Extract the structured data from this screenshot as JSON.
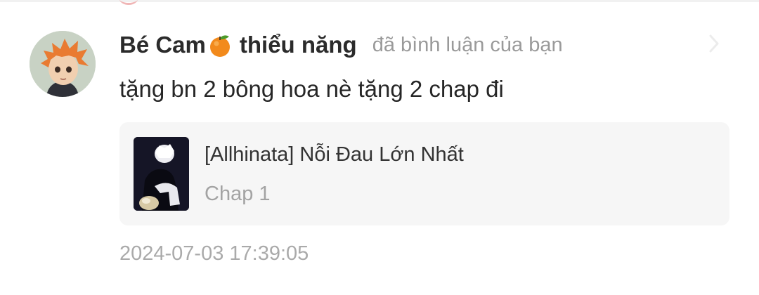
{
  "notification": {
    "user": {
      "name_prefix": "Bé Cam",
      "name_emoji": "orange-emoji",
      "name_suffix": "thiểu năng",
      "avatar": "anime-character-avatar"
    },
    "action_text": "đã bình luận của bạn",
    "comment": "tặng bn 2 bông hoa nè tặng 2 chap đi",
    "story": {
      "title": "[Allhinata] Nỗi Đau Lớn Nhất",
      "chapter": "Chap 1",
      "cover": "story-cover-image"
    },
    "timestamp": "2024-07-03 17:39:05",
    "chevron_icon": "chevron-right-icon"
  },
  "colors": {
    "background": "#ffffff",
    "card_background": "#f6f6f6",
    "primary_text": "#262626",
    "secondary_text": "#9a9a9a",
    "divider": "#f1f1f1"
  }
}
